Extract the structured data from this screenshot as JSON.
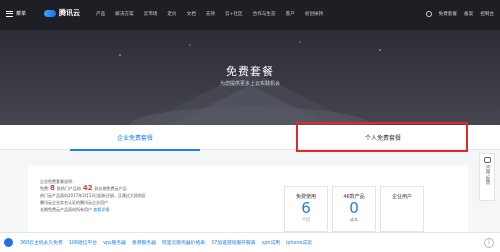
{
  "nav": {
    "menu_label": "菜单",
    "brand": "腾讯云",
    "links": [
      "产品",
      "解决方案",
      "云市场",
      "定价",
      "文档",
      "支持",
      "云+社区",
      "合作与生态",
      "客户",
      "初创扶持"
    ],
    "right": [
      "免费套餐",
      "备案",
      "控制台"
    ]
  },
  "hero": {
    "title": "免费套餐",
    "subtitle": "为您提供更多上云实践机会"
  },
  "tabs": [
    "企业免费套餐",
    "个人免费套餐"
  ],
  "content": {
    "desc_line1": "企业免费套餐说明：",
    "desc_line2_a": "免费",
    "desc_line2_num1": "8",
    "desc_line2_b": "款热门产品和",
    "desc_line2_num2": "42",
    "desc_line2_c": "款长期免费云产品",
    "desc_line3": "热门云产品面向2017年3月13日起新注册，且通过大陆地区",
    "desc_line4": "腾讯云企业实名认证的腾讯云企业用户",
    "desc_line5_a": "长期免费云产品面向所有用户",
    "desc_line5_link": "查看详细",
    "cards": [
      {
        "label": "免费使用",
        "num": "6",
        "unit": "个月"
      },
      {
        "label": "46款产品",
        "num": "0",
        "unit": "成本"
      },
      {
        "label": "企业用户",
        "num": "",
        "unit": ""
      }
    ]
  },
  "side": {
    "label": "咨询·反馈"
  },
  "bottom_links": [
    "360云主机永久免费",
    "106短信平台",
    "vps服务器",
    "香港服务器",
    "阿里云服务器价格表",
    "37加速游戏服开服表",
    "vpn试用",
    "iphone试玩"
  ],
  "colors": {
    "accent": "#1e7ff0",
    "highlight_box": "#e02a2a",
    "nav_bg": "#1e1f24"
  }
}
